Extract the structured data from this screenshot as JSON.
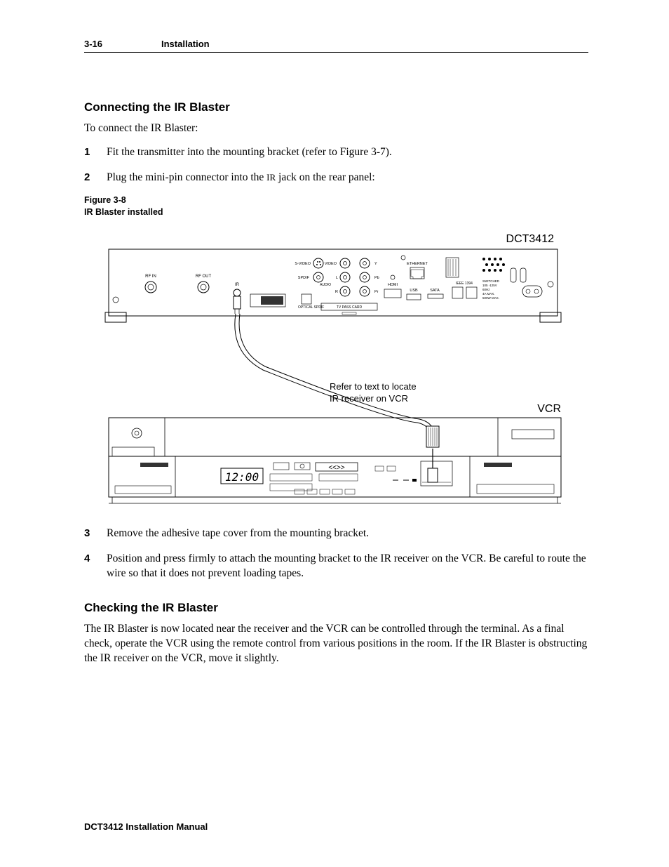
{
  "header": {
    "page_number": "3-16",
    "section": "Installation"
  },
  "section1": {
    "heading": "Connecting the IR Blaster",
    "intro": "To connect the IR Blaster:",
    "step1_num": "1",
    "step1_text": "Fit the transmitter into the mounting bracket (refer to Figure 3-7).",
    "step2_num": "2",
    "step2_text_before": "Plug the mini-pin connector into the ",
    "step2_text_sc": "IR",
    "step2_text_after": " jack on the rear panel:"
  },
  "figure": {
    "caption_line1": "Figure 3-8",
    "caption_line2": "IR Blaster installed",
    "device_label": "DCT3412",
    "vcr_label": "VCR",
    "annotation_line1": "Refer to text to locate",
    "annotation_line2": "IR receiver on VCR",
    "time_display": "12:00",
    "ports": {
      "rf_in": "RF IN",
      "rf_out": "RF OUT",
      "ir": "IR",
      "svideo": "S-VIDEO",
      "video": "VIDEO",
      "spdif": "SPDIF",
      "audio": "AUDIO",
      "optical": "OPTICAL SPDIF",
      "tv_pass": "TV PASS CARD",
      "ethernet": "ETHERNET",
      "hdmi": "HDMI",
      "usb": "USB",
      "sata": "SATA",
      "ieee1394": "IEEE 1394",
      "power": "SWITCHED 105 -125V 60Hz 4A MAX. 500W MAX.",
      "y": "Y",
      "pb": "Pb",
      "pr": "Pr",
      "l": "L",
      "r": "R"
    }
  },
  "section1_cont": {
    "step3_num": "3",
    "step3_text": "Remove the adhesive tape cover from the mounting bracket.",
    "step4_num": "4",
    "step4_text": "Position and press firmly to attach the mounting bracket to the IR receiver on the VCR. Be careful to route the wire so that it does not prevent loading tapes."
  },
  "section2": {
    "heading": "Checking the IR Blaster",
    "body": "The IR Blaster is now located near the receiver and the VCR can be controlled through the terminal. As a final check, operate the VCR using the remote control from various positions in the room. If the IR Blaster is obstructing the IR receiver on the VCR, move it slightly."
  },
  "footer": "DCT3412 Installation Manual"
}
